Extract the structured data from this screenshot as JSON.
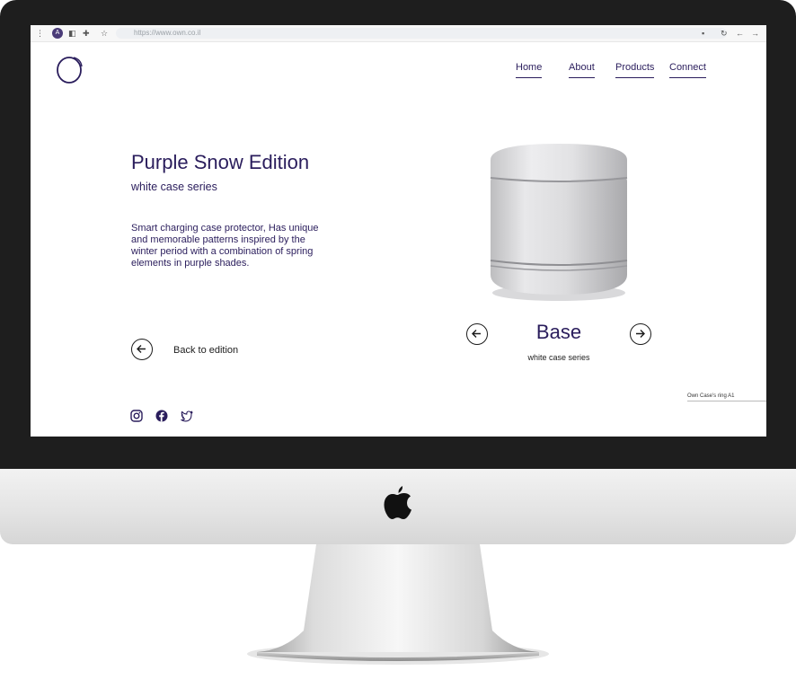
{
  "browser": {
    "url": "https://www.own.co.il",
    "profile_initial": "A"
  },
  "nav": {
    "home": "Home",
    "about": "About",
    "products": "Products",
    "connect": "Connect"
  },
  "hero": {
    "title": "Purple Snow Edition",
    "subtitle": "white case series",
    "description": "Smart charging case protector, Has unique and memorable patterns inspired by the winter period with a combination of spring elements in purple shades.",
    "back_label": "Back to edition"
  },
  "product": {
    "name": "Base",
    "series": "white case series",
    "footnote": "Own Case's ring A1"
  },
  "social": [
    "instagram-icon",
    "facebook-icon",
    "twitter-icon"
  ],
  "colors": {
    "brand": "#2a1d5c",
    "bezel": "#1e1e1e"
  }
}
